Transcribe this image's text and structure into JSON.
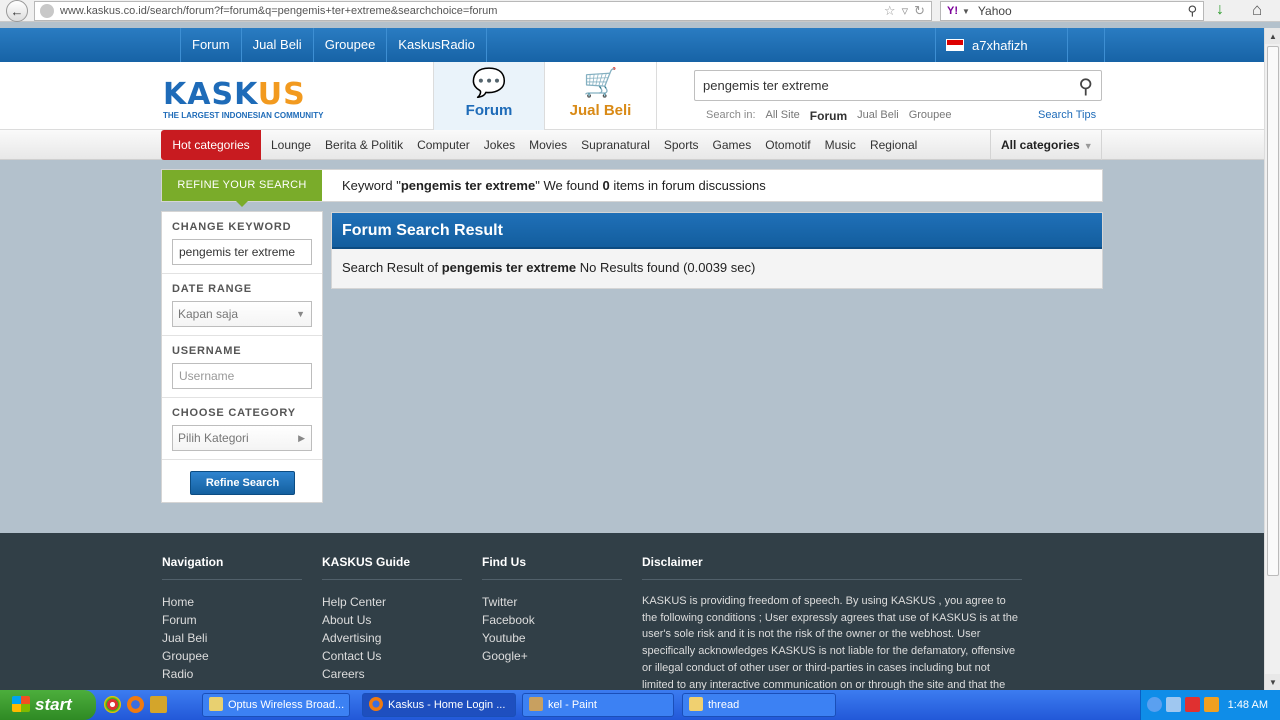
{
  "browser": {
    "url": "www.kaskus.co.id/search/forum?f=forum&q=pengemis+ter+extreme&searchchoice=forum",
    "search_provider": "Yahoo"
  },
  "topnav": {
    "links": [
      "Forum",
      "Jual Beli",
      "Groupee",
      "KaskusRadio"
    ],
    "username": "a7xhafizh"
  },
  "header": {
    "logo": "KASKUS",
    "logo_tagline": "THE LARGEST INDONESIAN COMMUNITY",
    "tabs": [
      {
        "label": "Forum"
      },
      {
        "label": "Jual Beli"
      }
    ],
    "search_value": "pengemis ter extreme",
    "search_in_label": "Search in:",
    "search_in_options": [
      "All Site",
      "Forum",
      "Jual Beli",
      "Groupee"
    ],
    "search_tips": "Search Tips"
  },
  "catbar": {
    "hot": "Hot categories",
    "items": [
      "Lounge",
      "Berita & Politik",
      "Computer",
      "Jokes",
      "Movies",
      "Supranatural",
      "Sports",
      "Games",
      "Otomotif",
      "Music",
      "Regional"
    ],
    "all": "All categories"
  },
  "refine": {
    "tab": "REFINE YOUR SEARCH",
    "msg_pre": "Keyword \"",
    "keyword": "pengemis ter extreme",
    "msg_mid": "\" We found ",
    "count": "0",
    "msg_post": " items in forum discussions"
  },
  "sidebar": {
    "keyword_label": "CHANGE KEYWORD",
    "keyword_value": "pengemis ter extreme",
    "date_label": "DATE RANGE",
    "date_value": "Kapan saja",
    "username_label": "USERNAME",
    "username_placeholder": "Username",
    "category_label": "CHOOSE CATEGORY",
    "category_value": "Pilih Kategori",
    "button": "Refine Search"
  },
  "result": {
    "title": "Forum Search Result",
    "pre": "Search Result of ",
    "keyword": "pengemis ter extreme",
    "post": " No Results found (0.0039 sec)"
  },
  "footer": {
    "navigation": {
      "title": "Navigation",
      "items": [
        "Home",
        "Forum",
        "Jual Beli",
        "Groupee",
        "Radio"
      ]
    },
    "guide": {
      "title": "KASKUS Guide",
      "items": [
        "Help Center",
        "About Us",
        "Advertising",
        "Contact Us",
        "Careers"
      ]
    },
    "findus": {
      "title": "Find Us",
      "items": [
        "Twitter",
        "Facebook",
        "Youtube",
        "Google+"
      ]
    },
    "disclaimer": {
      "title": "Disclaimer",
      "text": "KASKUS is providing freedom of speech. By using KASKUS , you agree to the following conditions ; User expressly agrees that use of KASKUS is at the user's sole risk and it is not the risk of the owner or the webhost. User specifically acknowledges KASKUS is not liable for the defamatory, offensive or illegal conduct of other user or third-parties in cases including but not limited to any interactive communication on or through the site and that the risk from"
    }
  },
  "taskbar": {
    "start": "start",
    "items": [
      "Optus Wireless Broad...",
      "Kaskus - Home Login ...",
      "kel - Paint",
      "thread"
    ],
    "clock": "1:48 AM"
  }
}
